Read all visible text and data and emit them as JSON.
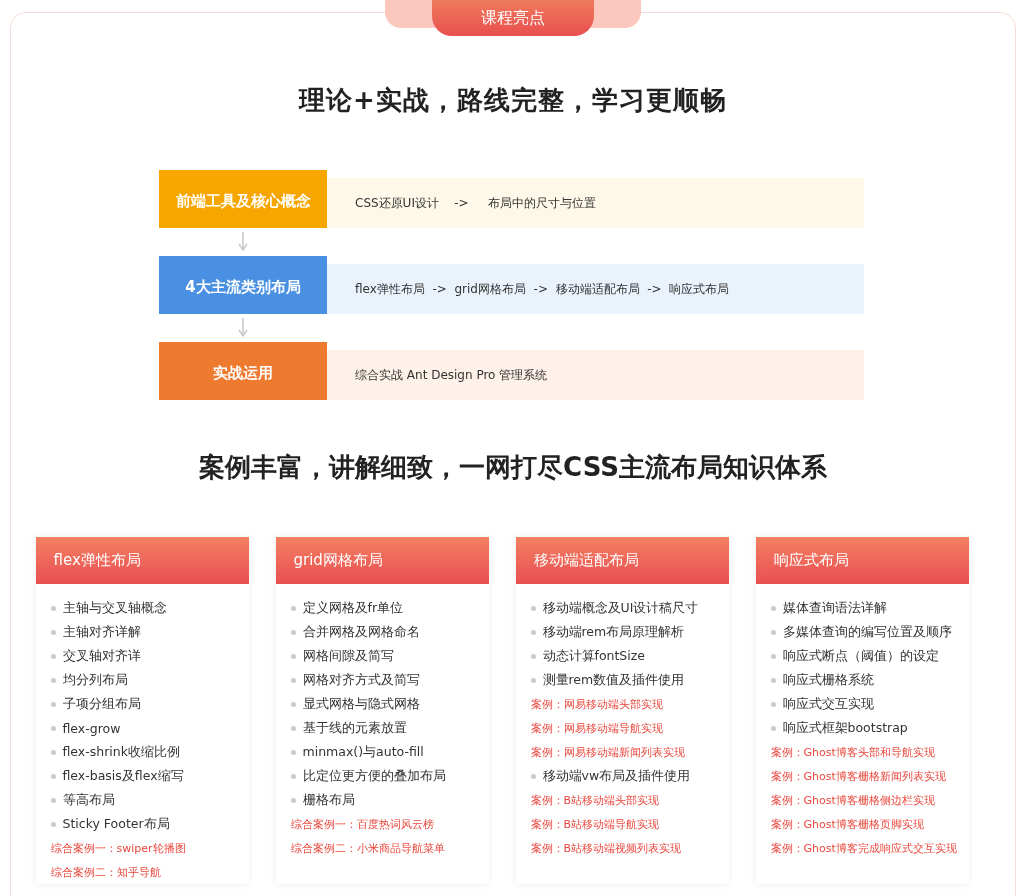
{
  "badge": "课程亮点",
  "headline": "理论+实战，路线完整，学习更顺畅",
  "steps": [
    {
      "label": "前端工具及核心概念",
      "path": "CSS还原UI设计    ->     布局中的尺寸与位置",
      "color": "#f7a600"
    },
    {
      "label": "4大主流类别布局",
      "path": "flex弹性布局  ->  grid网格布局  ->  移动端适配布局  ->  响应式布局",
      "color": "#4a90e2"
    },
    {
      "label": "实战运用",
      "path": "综合实战 Ant Design Pro 管理系统",
      "color": "#ee7a30"
    }
  ],
  "subheadline": "案例丰富，讲解细致，一网打尽CSS主流布局知识体系",
  "columns": [
    {
      "title": "flex弹性布局",
      "items": [
        {
          "kind": "topic",
          "text": "主轴与交叉轴概念"
        },
        {
          "kind": "topic",
          "text": "主轴对齐详解"
        },
        {
          "kind": "topic",
          "text": "交叉轴对齐详"
        },
        {
          "kind": "topic",
          "text": "均分列布局"
        },
        {
          "kind": "topic",
          "text": "子项分组布局"
        },
        {
          "kind": "topic",
          "text": "flex-grow"
        },
        {
          "kind": "topic",
          "text": "flex-shrink收缩比例"
        },
        {
          "kind": "topic",
          "text": "flex-basis及flex缩写"
        },
        {
          "kind": "topic",
          "text": "等高布局"
        },
        {
          "kind": "topic",
          "text": "Sticky Footer布局"
        },
        {
          "kind": "case",
          "text": "综合案例一：swiper轮播图"
        },
        {
          "kind": "case",
          "text": "综合案例二：知乎导航"
        }
      ]
    },
    {
      "title": "grid网格布局",
      "items": [
        {
          "kind": "topic",
          "text": "定义网格及fr单位"
        },
        {
          "kind": "topic",
          "text": "合并网格及网格命名"
        },
        {
          "kind": "topic",
          "text": "网格间隙及简写"
        },
        {
          "kind": "topic",
          "text": "网格对齐方式及简写"
        },
        {
          "kind": "topic",
          "text": "显式网格与隐式网格"
        },
        {
          "kind": "topic",
          "text": "基于线的元素放置"
        },
        {
          "kind": "topic",
          "text": "minmax()与auto-fill"
        },
        {
          "kind": "topic",
          "text": "比定位更方便的叠加布局"
        },
        {
          "kind": "topic",
          "text": "栅格布局"
        },
        {
          "kind": "case",
          "text": "综合案例一：百度热词风云榜"
        },
        {
          "kind": "case",
          "text": "综合案例二：小米商品导航菜单"
        }
      ]
    },
    {
      "title": "移动端适配布局",
      "items": [
        {
          "kind": "topic",
          "text": "移动端概念及UI设计稿尺寸"
        },
        {
          "kind": "topic",
          "text": "移动端rem布局原理解析"
        },
        {
          "kind": "topic",
          "text": "动态计算fontSize"
        },
        {
          "kind": "topic",
          "text": "测量rem数值及插件使用"
        },
        {
          "kind": "case",
          "text": "案例：网易移动端头部实现"
        },
        {
          "kind": "case",
          "text": "案例：网易移动端导航实现"
        },
        {
          "kind": "case",
          "text": "案例：网易移动端新闻列表实现"
        },
        {
          "kind": "topic",
          "text": "移动端vw布局及插件使用"
        },
        {
          "kind": "case",
          "text": "案例：B站移动端头部实现"
        },
        {
          "kind": "case",
          "text": "案例：B站移动端导航实现"
        },
        {
          "kind": "case",
          "text": "案例：B站移动端视频列表实现"
        }
      ]
    },
    {
      "title": "响应式布局",
      "items": [
        {
          "kind": "topic",
          "text": "媒体查询语法详解"
        },
        {
          "kind": "topic",
          "text": "多媒体查询的编写位置及顺序"
        },
        {
          "kind": "topic",
          "text": "响应式断点（阈值）的设定"
        },
        {
          "kind": "topic",
          "text": "响应式栅格系统"
        },
        {
          "kind": "topic",
          "text": "响应式交互实现"
        },
        {
          "kind": "topic",
          "text": "响应式框架bootstrap"
        },
        {
          "kind": "case",
          "text": "案例：Ghost博客头部和导航实现"
        },
        {
          "kind": "case",
          "text": "案例：Ghost博客栅格新闻列表实现"
        },
        {
          "kind": "case",
          "text": "案例：Ghost博客栅格侧边栏实现"
        },
        {
          "kind": "case",
          "text": "案例：Ghost博客栅格页脚实现"
        },
        {
          "kind": "case",
          "text": "案例：Ghost博客完成响应式交互实现"
        }
      ]
    }
  ]
}
